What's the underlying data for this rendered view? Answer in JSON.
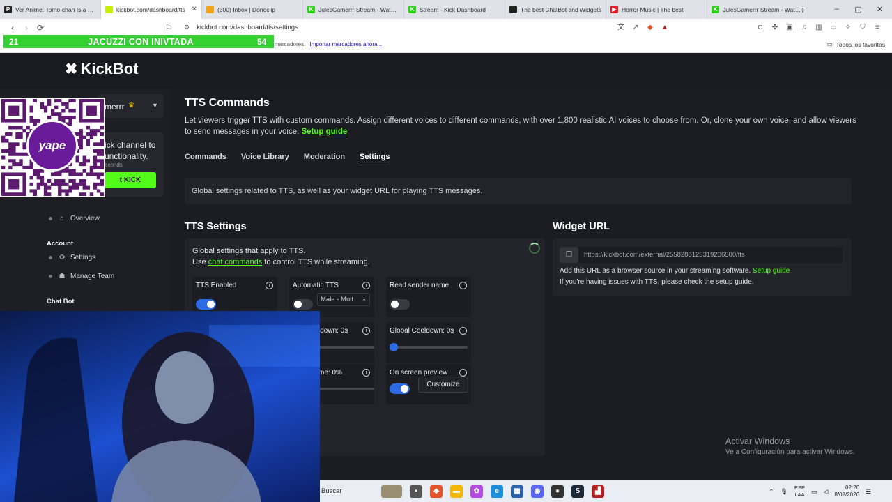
{
  "browser": {
    "tabs": [
      {
        "label": "Ver Anime: Tomo-chan Is a Girl",
        "fav": "P",
        "favColor": "#222222"
      },
      {
        "label": "kickbot.com/dashboard/tts",
        "fav": "",
        "favColor": "#c6f000",
        "active": true
      },
      {
        "label": "(300) Inbox | Donoclip",
        "fav": "",
        "favColor": "#f2a31b"
      },
      {
        "label": "JulesGamerrr Stream - Watch Li",
        "fav": "K",
        "favColor": "#2ad015"
      },
      {
        "label": "Stream - Kick Dashboard",
        "fav": "K",
        "favColor": "#2ad015"
      },
      {
        "label": "The best ChatBot and Widgets",
        "fav": "",
        "favColor": "#222222"
      },
      {
        "label": "Horror Music | The best",
        "fav": "▶",
        "favColor": "#e01b24"
      },
      {
        "label": "JulesGamerrr Stream - Watch Li",
        "fav": "K",
        "favColor": "#2ad015"
      }
    ],
    "url": "kickbot.com/dashboard/tts/settings",
    "bookmarks_text": "marcadores aquí en la barra de marcadores.",
    "bookmarks_link": "Importar marcadores ahora...",
    "bookmarks_right": "Todos los favoritos"
  },
  "overlay": {
    "left_num": "21",
    "title": "JACUZZI CON INIVTADA",
    "right_num": "54"
  },
  "app": {
    "logo": "KickBot",
    "user_name": "merrr",
    "connect_text": "ick channel to unctionality.",
    "connect_sub": "econds",
    "connect_button": "t KICK",
    "nav": {
      "overview": "Overview",
      "account_head": "Account",
      "settings": "Settings",
      "manage_team": "Manage Team",
      "chatbot_head": "Chat Bot"
    }
  },
  "page": {
    "title": "TTS Commands",
    "description": "Let viewers trigger TTS with custom commands. Assign different voices to different commands, with over 1,800 realistic AI voices to choose from. Or, clone your own voice, and allow viewers to send messages in your voice.",
    "setup_link": "Setup guide",
    "tabs": [
      "Commands",
      "Voice Library",
      "Moderation",
      "Settings"
    ],
    "selected_tab": "Settings",
    "info": "Global settings related to TTS, as well as your widget URL for playing TTS messages."
  },
  "tts_settings": {
    "heading": "TTS Settings",
    "line1": "Global settings that apply to TTS.",
    "line2_pre": "Use",
    "line2_link": "chat commands",
    "line2_post": "to control TTS while streaming.",
    "tts_enabled": {
      "label": "TTS Enabled",
      "on": true
    },
    "automatic_tts": {
      "label": "Automatic TTS",
      "on": false,
      "voice": "Male - Mult"
    },
    "read_sender": {
      "label": "Read sender name",
      "on": false
    },
    "cooldown": {
      "label": "ldown: 0s",
      "value": 0
    },
    "global_cooldown": {
      "label": "Global Cooldown: 0s",
      "value": 0
    },
    "volume": {
      "label": "me: 0%",
      "value": 0
    },
    "on_screen_preview": {
      "label": "On screen preview",
      "on": true
    },
    "customize_button": "Customize"
  },
  "widget": {
    "heading": "Widget URL",
    "url": "https://kickbot.com/external/2558286125319206500/tts",
    "line1": "Add this URL as a browser source in your streaming software.",
    "line1_link": "Setup guide",
    "line2": "If you're having issues with TTS, please check the setup guide."
  },
  "watermark": {
    "line1": "Activar Windows",
    "line2": "Ve a Configuración para activar Windows."
  },
  "taskbar": {
    "search": "Buscar",
    "lang_top": "ESP",
    "lang_bottom": "LAA",
    "time": "02:20",
    "date": "8/02/2026"
  },
  "colors": {
    "kick_green": "#53fc18",
    "toggle_blue": "#2d6be4",
    "panel": "#23242a",
    "background": "#1c1d22"
  }
}
